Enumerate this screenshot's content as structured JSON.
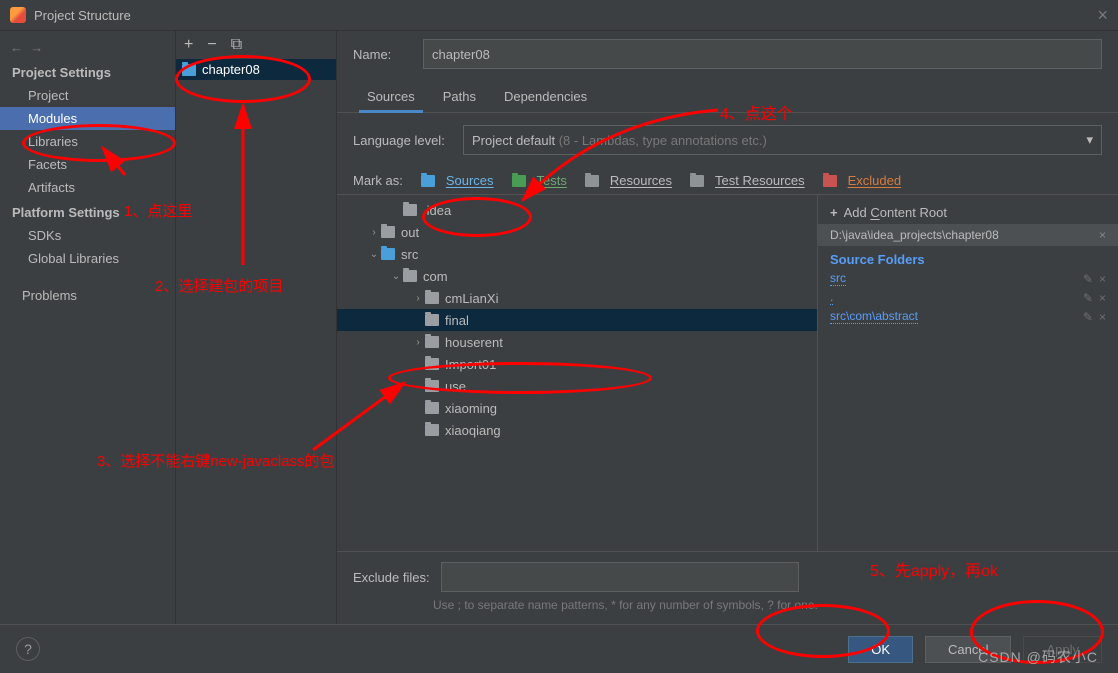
{
  "window": {
    "title": "Project Structure"
  },
  "sidebar": {
    "heading1": "Project Settings",
    "items1": [
      "Project",
      "Modules",
      "Libraries",
      "Facets",
      "Artifacts"
    ],
    "heading2": "Platform Settings",
    "items2": [
      "SDKs",
      "Global Libraries"
    ],
    "problems": "Problems",
    "selected": "Modules"
  },
  "module_tree": {
    "selected": "chapter08"
  },
  "main": {
    "name_label": "Name:",
    "name_value": "chapter08",
    "tabs": [
      "Sources",
      "Paths",
      "Dependencies"
    ],
    "active_tab": "Sources",
    "lang_label": "Language level:",
    "lang_value": "Project default ",
    "lang_hint": "(8 - Lambdas, type annotations etc.)",
    "mark_label": "Mark as:",
    "marks": {
      "sources": "Sources",
      "tests": "Tests",
      "resources": "Resources",
      "test_resources": "Test Resources",
      "excluded": "Excluded"
    },
    "tree": [
      {
        "depth": 1,
        "chev": "",
        "icon": "grey",
        "name": ".idea"
      },
      {
        "depth": 0,
        "chev": "›",
        "icon": "grey",
        "name": "out"
      },
      {
        "depth": 0,
        "chev": "⌄",
        "icon": "blue",
        "name": "src"
      },
      {
        "depth": 1,
        "chev": "⌄",
        "icon": "grey",
        "name": "com"
      },
      {
        "depth": 2,
        "chev": "›",
        "icon": "grey",
        "name": "cmLianXi"
      },
      {
        "depth": 2,
        "chev": "",
        "icon": "grey",
        "name": "final",
        "sel": true
      },
      {
        "depth": 2,
        "chev": "›",
        "icon": "grey",
        "name": "houserent"
      },
      {
        "depth": 2,
        "chev": "",
        "icon": "grey",
        "name": "Import01"
      },
      {
        "depth": 2,
        "chev": "",
        "icon": "grey",
        "name": "use"
      },
      {
        "depth": 2,
        "chev": "",
        "icon": "grey",
        "name": "xiaoming"
      },
      {
        "depth": 2,
        "chev": "",
        "icon": "grey",
        "name": "xiaoqiang"
      }
    ],
    "exclude_label": "Exclude files:",
    "exclude_hint": "Use ; to separate name patterns, * for any number of symbols, ? for one."
  },
  "right": {
    "add_root": "Add Content Root",
    "content_root": "D:\\java\\idea_projects\\chapter08",
    "src_heading": "Source Folders",
    "folders": [
      "src",
      ".",
      "src\\com\\abstract"
    ]
  },
  "footer": {
    "ok": "OK",
    "cancel": "Cancel",
    "apply": "Apply"
  },
  "annotations": {
    "a1": "1、点这里",
    "a2": "2、选择建包的项目",
    "a3": "3、选择不能右键new-javaclass的包",
    "a4": "4、点这个",
    "a5": "5、先apply，再ok"
  },
  "watermark": "CSDN @码农小C"
}
